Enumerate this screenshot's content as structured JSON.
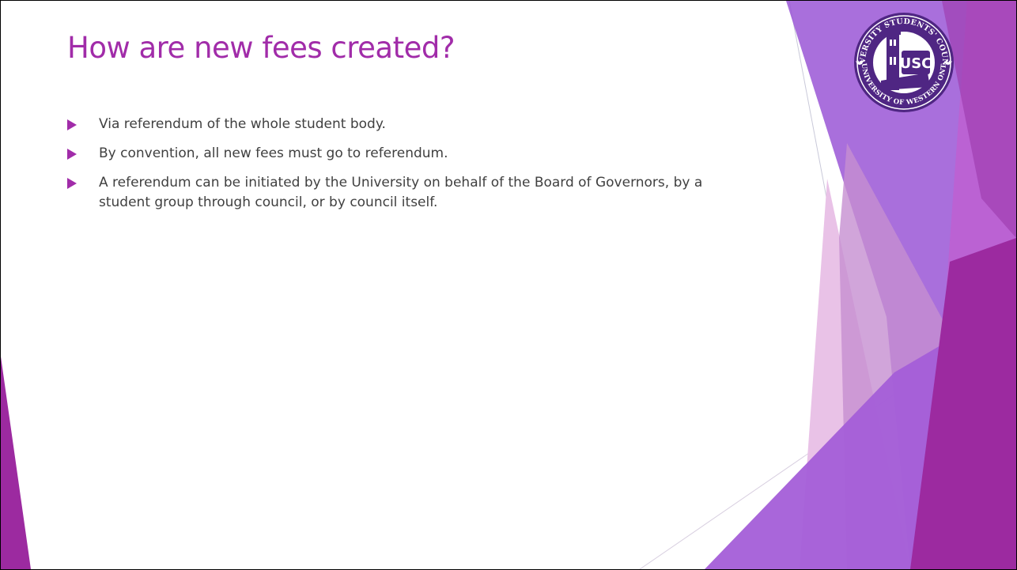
{
  "slide": {
    "title": "How are new fees created?",
    "bullets": [
      {
        "text": "Via referendum of the whole student body."
      },
      {
        "text": "By convention, all new fees must go to referendum."
      },
      {
        "text": "A referendum can be initiated by the University on behalf of the Board of Governors, by a student group through council, or by council itself."
      }
    ]
  },
  "logo": {
    "top_arc": "UNIVERSITY STUDENTS' COUNCIL",
    "bottom_arc": "THE UNIVERSITY OF WESTERN ONTARIO",
    "monogram": "USC"
  },
  "colors": {
    "title": "#a12ca9",
    "body_text": "#404040",
    "accent": "#a12ca9",
    "logo_purple": "#4f2683",
    "shape_light": "#e8b9e6",
    "shape_violet": "#8a4cc9",
    "shape_magenta": "#9c2aa0"
  }
}
